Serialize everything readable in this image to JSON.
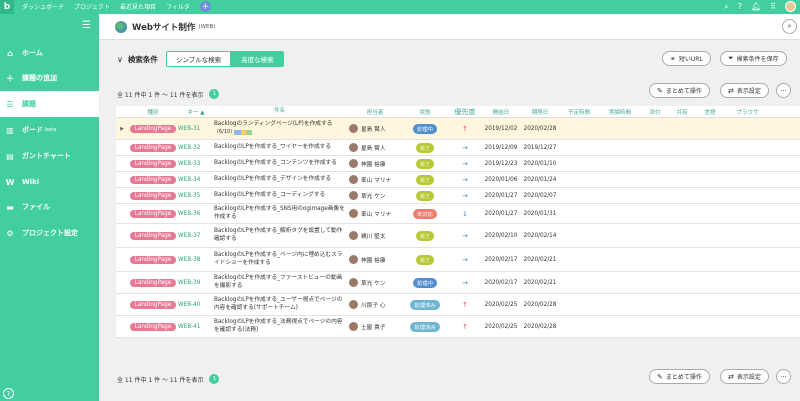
{
  "topbar": {
    "logo": "b",
    "nav": [
      "ダッシュボード",
      "プロジェクト",
      "最近見た項目",
      "フィルタ"
    ],
    "add": "+"
  },
  "sidebar": {
    "items": [
      {
        "label": "ホーム",
        "icon": "⌂",
        "icon_name": "home-icon"
      },
      {
        "label": "課題の追加",
        "icon": "＋",
        "icon_name": "plus-icon"
      },
      {
        "label": "課題",
        "icon": "☰",
        "icon_name": "list-icon"
      },
      {
        "label": "ボード",
        "sup": "beta",
        "icon": "▥",
        "icon_name": "board-icon"
      },
      {
        "label": "ガントチャート",
        "icon": "▤",
        "icon_name": "gantt-icon"
      },
      {
        "label": "Wiki",
        "icon": "W",
        "icon_name": "wiki-icon"
      },
      {
        "label": "ファイル",
        "icon": "▬",
        "icon_name": "folder-icon"
      },
      {
        "label": "プロジェクト設定",
        "icon": "⚙",
        "icon_name": "gear-icon"
      }
    ],
    "help": "?"
  },
  "project": {
    "name": "Webサイト制作",
    "key": "(WEB)"
  },
  "search_condition": {
    "label": "検索条件",
    "simple": "シンプルな検索",
    "advanced": "高度な検索",
    "short_url": "短いURL",
    "save": "検索条件を保存"
  },
  "summary": {
    "count_text": "全 11 件中 1 件 〜 11 件を表示",
    "page": "1",
    "bulk": "まとめて操作",
    "display": "表示設定",
    "more": "···"
  },
  "columns": [
    "種別",
    "キー",
    "件名",
    "担当者",
    "状態",
    "優先度",
    "開始日",
    "期限日",
    "予定時間",
    "実績時間",
    "添付",
    "共有",
    "言語",
    "ブラウザ"
  ],
  "status_colors": {
    "処理中": "#4f8fd0",
    "完了": "#b5c934",
    "未対応": "#ee7c70",
    "処理済み": "#6db5d0"
  },
  "rows": [
    {
      "type": "LandingPage",
      "key": "WEB-31",
      "name": "Backlogのランディングページ(LP)を作成する",
      "progress": "(6/10)",
      "user": "星島 賢人",
      "status": "処理中",
      "priority": "↑",
      "start": "2019/12/02",
      "due": "2020/02/28",
      "highlight": true
    },
    {
      "type": "LandingPage",
      "key": "WEB-32",
      "name": "BacklogのLPを作成する_ワイヤーを作成する",
      "user": "星島 賢人",
      "status": "完了",
      "priority": "→",
      "start": "2019/12/09",
      "due": "2019/12/27"
    },
    {
      "type": "LandingPage",
      "key": "WEB-33",
      "name": "BacklogのLPを作成する_コンテンツを作成する",
      "user": "神園 裕康",
      "status": "完了",
      "priority": "→",
      "start": "2019/12/23",
      "due": "2020/01/10"
    },
    {
      "type": "LandingPage",
      "key": "WEB-34",
      "name": "BacklogのLPを作成する_デザインを作成する",
      "user": "峯山 マリナ",
      "status": "完了",
      "priority": "→",
      "start": "2020/01/06",
      "due": "2020/01/24"
    },
    {
      "type": "LandingPage",
      "key": "WEB-35",
      "name": "BacklogのLPを作成する_コーディングする",
      "user": "草光 ケン",
      "status": "完了",
      "priority": "→",
      "start": "2020/01/27",
      "due": "2020/02/07"
    },
    {
      "type": "LandingPage",
      "key": "WEB-36",
      "name": "BacklogのLPを作成する_SNS用のogimage画像を作成する",
      "user": "峯山 マリナ",
      "status": "未対応",
      "priority": "↓",
      "start": "2020/01/27",
      "due": "2020/01/31"
    },
    {
      "type": "LandingPage",
      "key": "WEB-37",
      "name": "BacklogのLPを作成する_解析タグを設置して動作確認する",
      "user": "鵜川 堅太",
      "status": "完了",
      "priority": "→",
      "start": "2020/02/10",
      "due": "2020/02/14"
    },
    {
      "type": "LandingPage",
      "key": "WEB-38",
      "name": "BacklogのLPを作成する_ページ内に埋め込むスライドショーを作成する",
      "user": "神園 裕康",
      "status": "完了",
      "priority": "→",
      "start": "2020/02/17",
      "due": "2020/02/21"
    },
    {
      "type": "LandingPage",
      "key": "WEB-39",
      "name": "BacklogのLPを作成する_ファーストビューの動画を撮影する",
      "user": "草光 ケン",
      "status": "処理中",
      "priority": "→",
      "start": "2020/02/17",
      "due": "2020/02/21"
    },
    {
      "type": "LandingPage",
      "key": "WEB-40",
      "name": "BacklogのLPを作成する_ユーザー視点でページの内容を確認する(サポートチーム)",
      "user": "川那子 心",
      "status": "処理済み",
      "priority": "↑",
      "start": "2020/02/25",
      "due": "2020/02/28"
    },
    {
      "type": "LandingPage",
      "key": "WEB-41",
      "name": "BacklogのLPを作成する_法務視点でページの内容を確認する(法務)",
      "user": "土屋 貴子",
      "status": "処理済み",
      "priority": "↑",
      "start": "2020/02/25",
      "due": "2020/02/28"
    }
  ]
}
